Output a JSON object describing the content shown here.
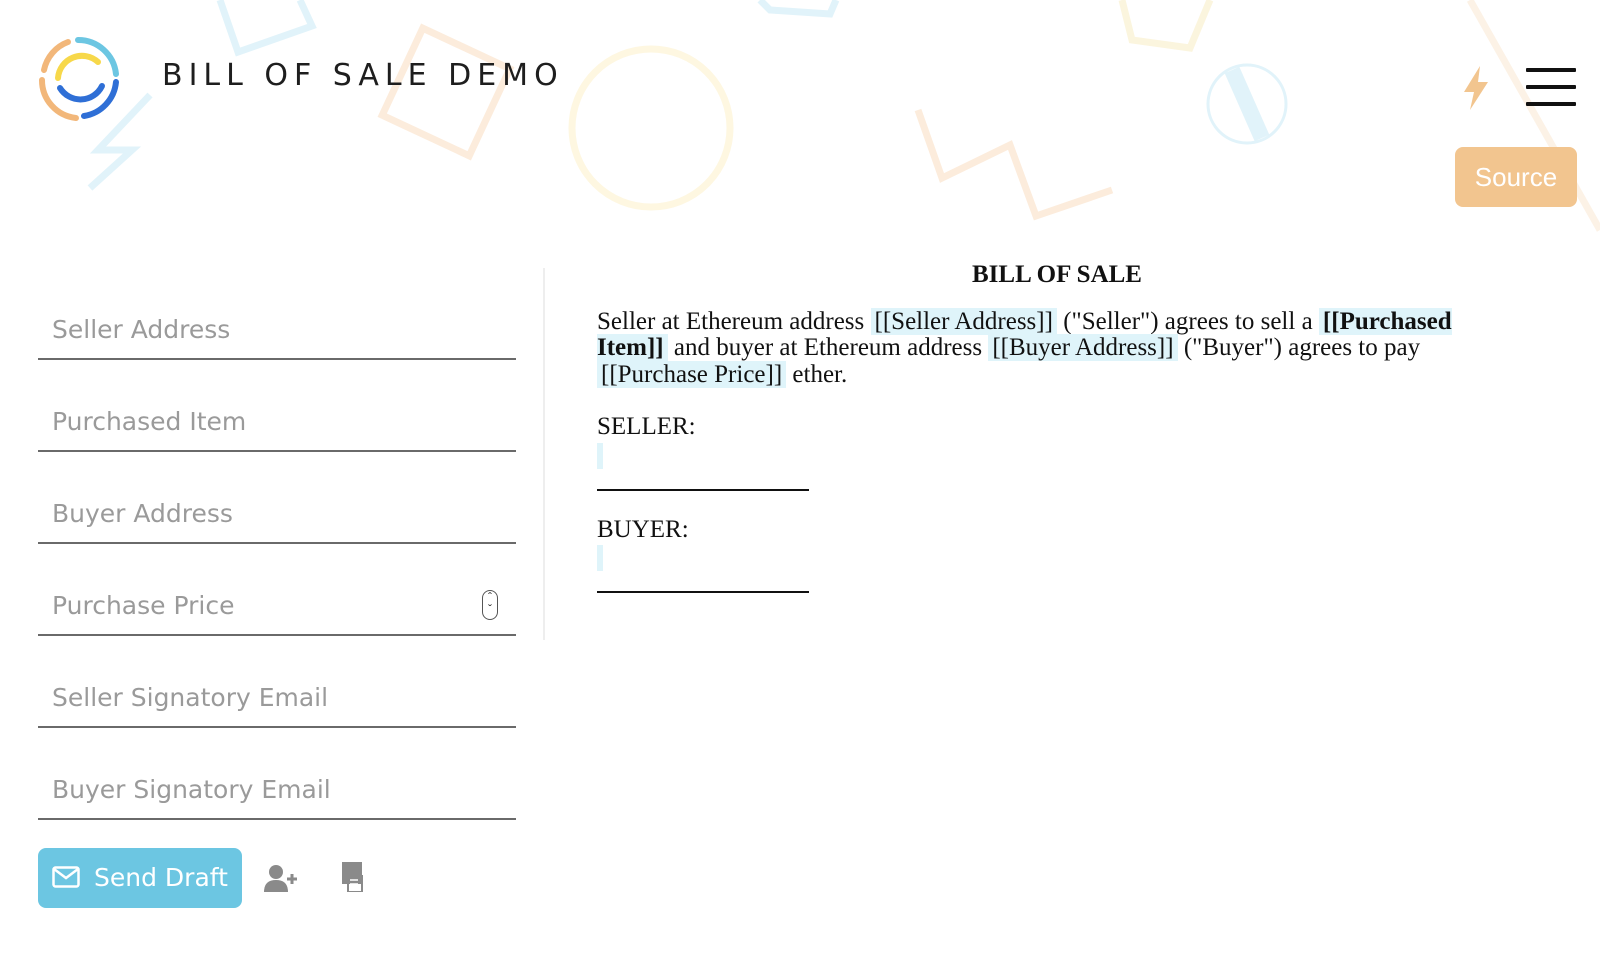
{
  "header": {
    "title": "BILL OF SALE DEMO",
    "logo_icon": "circular-logo-icon",
    "bolt_icon": "lightning-bolt-icon",
    "menu_icon": "hamburger-menu-icon",
    "source_label": "Source"
  },
  "form": {
    "fields": [
      {
        "placeholder": "Seller Address"
      },
      {
        "placeholder": "Purchased Item"
      },
      {
        "placeholder": "Buyer Address"
      },
      {
        "placeholder": "Purchase Price"
      },
      {
        "placeholder": "Seller Signatory Email"
      },
      {
        "placeholder": "Buyer Signatory Email"
      }
    ],
    "send_label": "Send Draft",
    "send_icon": "envelope-icon",
    "add_user_icon": "add-user-icon",
    "pages_icon": "document-pages-icon"
  },
  "document": {
    "title": "BILL OF SALE",
    "t1": "Seller at Ethereum address ",
    "v_seller": "[[Seller Address]]",
    "t2": " (\"Seller\") agrees to sell a ",
    "v_item": "[[Purchased Item]]",
    "t3": " and buyer at Ethereum address ",
    "v_buyer": "[[Buyer Address]]",
    "t4": " (\"Buyer\") agrees to pay ",
    "v_price": "[[Purchase Price]]",
    "t5": " ether.",
    "seller_label": "SELLER:",
    "buyer_label": "BUYER:"
  },
  "colors": {
    "accent_blue": "#6cc6e2",
    "source_orange": "#f2c58f",
    "highlight": "#dff4fa"
  }
}
